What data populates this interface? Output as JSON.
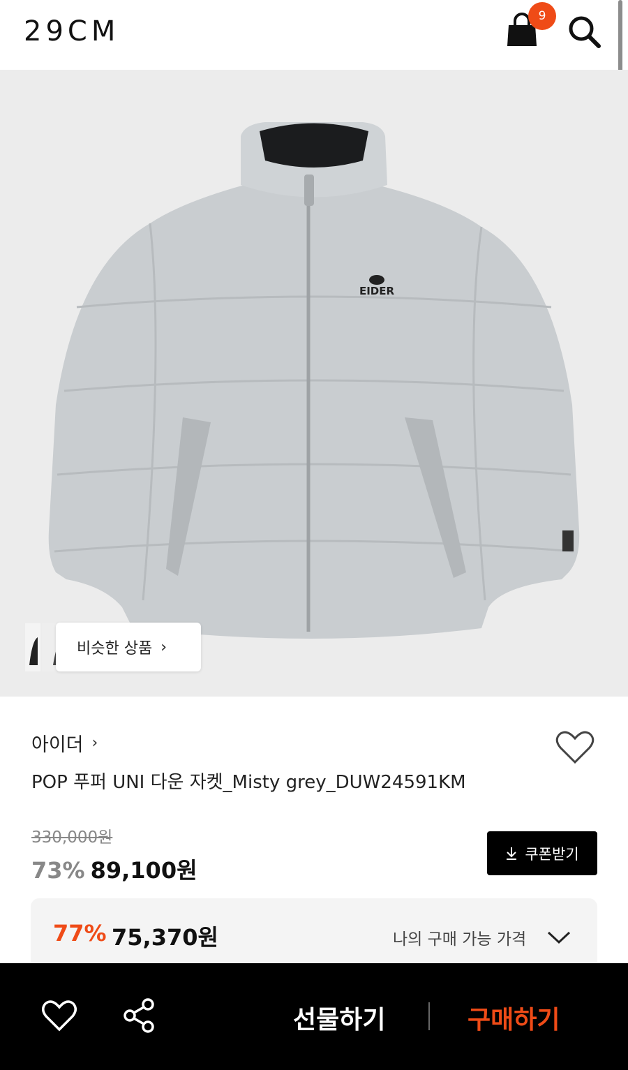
{
  "header": {
    "logo": "29CM",
    "cart_count": "9"
  },
  "product": {
    "brand": "아이더",
    "brand_chevron": "›",
    "title": "POP 푸퍼 UNI 다운 자켓_Misty grey_DUW24591KM",
    "image_logo_text": "EIDER",
    "original_price": "330,000원",
    "discount_rate": "73%",
    "sale_price": "89,100원",
    "coupon_label": "쿠폰받기",
    "my_discount_rate": "77%",
    "my_price": "75,370원",
    "my_price_label": "나의 구매 가능 가격"
  },
  "similar": {
    "label": "비슷한 상품",
    "chevron": "›"
  },
  "bottom_bar": {
    "gift_label": "선물하기",
    "buy_label": "구매하기"
  },
  "colors": {
    "accent": "#ef4b17",
    "image_bg": "#ececec",
    "jacket": "#c9cdd0"
  },
  "icons": [
    "cart-icon",
    "search-icon",
    "heart-icon",
    "share-icon",
    "download-icon",
    "chevron-down-icon",
    "chevron-right-icon"
  ]
}
